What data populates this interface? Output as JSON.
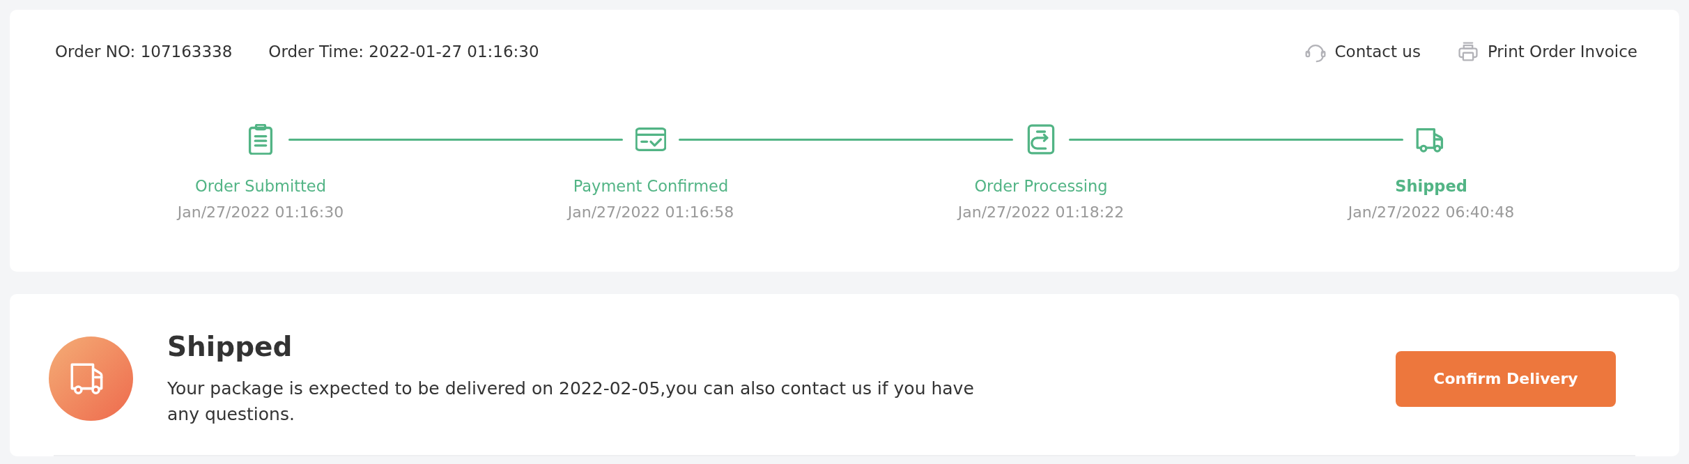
{
  "order": {
    "number": "Order NO: 107163338",
    "time": "Order Time: 2022-01-27 01:16:30"
  },
  "actions": [
    {
      "kind": "contact",
      "label": "Contact us"
    },
    {
      "kind": "print",
      "label": "Print Order Invoice"
    }
  ],
  "steps": [
    {
      "kind": "submitted",
      "title": "Order Submitted",
      "time": "Jan/27/2022 01:16:30",
      "completed": true,
      "current": false
    },
    {
      "kind": "payment",
      "title": "Payment Confirmed",
      "time": "Jan/27/2022 01:16:58",
      "completed": true,
      "current": false
    },
    {
      "kind": "processing",
      "title": "Order Processing",
      "time": "Jan/27/2022 01:18:22",
      "completed": true,
      "current": false
    },
    {
      "kind": "shipped",
      "title": "Shipped",
      "time": "Jan/27/2022 06:40:48",
      "completed": true,
      "current": true
    }
  ],
  "status": {
    "kind": "shipped",
    "title": "Shipped",
    "message": "Your package is expected to be delivered on 2022-02-05,you can also contact us if you have any questions.",
    "button": "Confirm Delivery"
  }
}
